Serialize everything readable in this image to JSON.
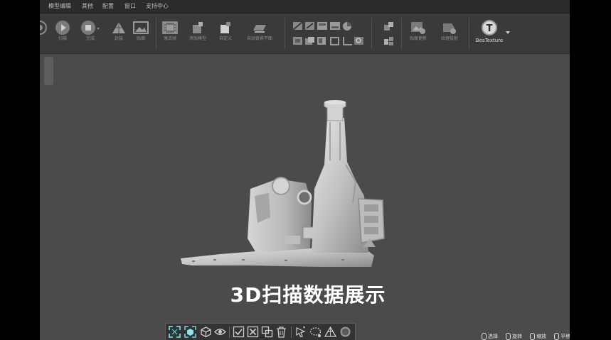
{
  "menubar": {
    "items": [
      "模型编辑",
      "其他",
      "配置",
      "窗口",
      "支持中心"
    ]
  },
  "ribbon": {
    "buttons": [
      {
        "label": "扫描",
        "icon": "play-icon"
      },
      {
        "label": "完成",
        "icon": "stop-icon"
      },
      {
        "label": "封装",
        "icon": "mesh-triangle-icon"
      },
      {
        "label": "贴图",
        "icon": "image-icon"
      },
      {
        "label": "激活帧",
        "icon": "film-frame-icon"
      },
      {
        "label": "添加模型",
        "icon": "cube-add-icon"
      },
      {
        "label": "自定义",
        "icon": "cube-custom-icon"
      },
      {
        "label": "自动背景平面",
        "icon": "background-plane-icon"
      },
      {
        "label": "贴图更新",
        "icon": "texture-update-icon"
      },
      {
        "label": "纹理投射",
        "icon": "texture-project-icon"
      },
      {
        "label": "BesTexture",
        "icon": "bestexture-logo-icon"
      }
    ]
  },
  "viewport": {
    "caption": "3D扫描数据展示",
    "model": "scanned-mechanical-housing"
  },
  "bottom_toolbar": {
    "tools": [
      "fit-view-icon",
      "iso-view-icon",
      "wireframe-cube-icon",
      "eye-visibility-icon",
      "select-all-icon",
      "deselect-icon",
      "invert-selection-icon",
      "delete-icon",
      "lasso-select-icon",
      "ellipse-select-icon",
      "mesh-triangle-icon",
      "point-display-icon"
    ]
  },
  "mouse_hints": [
    {
      "label": "选择"
    },
    {
      "label": "旋转"
    },
    {
      "label": "缩放"
    },
    {
      "label": "平移"
    }
  ],
  "colors": {
    "viewport_bg": "#4b4b4b",
    "ribbon_bg": "#3a3a3a",
    "menubar_bg": "#2b2b2b",
    "accent_cyan": "#6fd6e0"
  }
}
